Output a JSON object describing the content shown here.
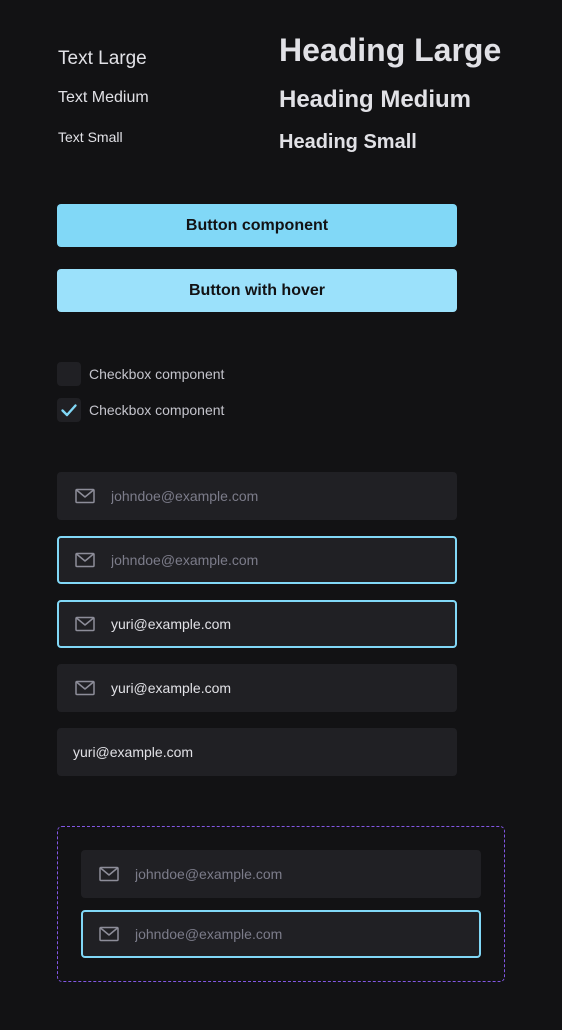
{
  "typography": {
    "text_large": "Text Large",
    "text_medium": "Text Medium",
    "text_small": "Text Small",
    "heading_large": "Heading Large",
    "heading_medium": "Heading Medium",
    "heading_small": "Heading Small"
  },
  "buttons": {
    "primary_label": "Button component",
    "hover_label": "Button with hover"
  },
  "checkboxes": [
    {
      "label": "Checkbox component",
      "checked": false
    },
    {
      "label": "Checkbox component",
      "checked": true
    }
  ],
  "inputs": [
    {
      "icon": "mail-icon",
      "placeholder": "johndoe@example.com",
      "value": "",
      "state": "default"
    },
    {
      "icon": "mail-icon",
      "placeholder": "johndoe@example.com",
      "value": "",
      "state": "focused"
    },
    {
      "icon": "mail-icon",
      "placeholder": "johndoe@example.com",
      "value": "yuri@example.com",
      "state": "focused"
    },
    {
      "icon": "mail-icon",
      "placeholder": "johndoe@example.com",
      "value": "yuri@example.com",
      "state": "default"
    },
    {
      "icon": "",
      "placeholder": "johndoe@example.com",
      "value": "yuri@example.com",
      "state": "default"
    }
  ],
  "group_inputs": [
    {
      "icon": "mail-icon",
      "placeholder": "johndoe@example.com",
      "value": "",
      "state": "default"
    },
    {
      "icon": "mail-icon",
      "placeholder": "johndoe@example.com",
      "value": "",
      "state": "focused"
    }
  ],
  "colors": {
    "background": "#121214",
    "surface": "#202024",
    "accent": "#81d8f7",
    "accent_hover": "#9be1fb",
    "group_border": "#8257e5",
    "text": "#e1e1e6",
    "placeholder": "#7c7c8a"
  }
}
